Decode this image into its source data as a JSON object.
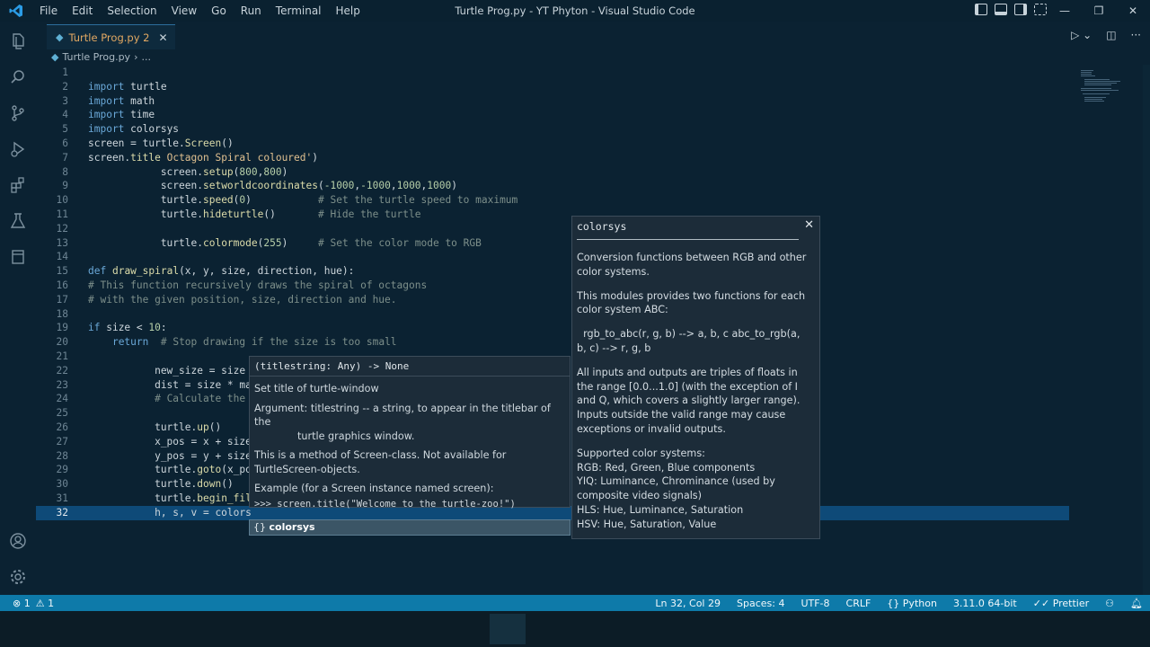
{
  "window": {
    "title": "Turtle Prog.py - YT Phyton - Visual Studio Code",
    "menu": [
      "File",
      "Edit",
      "Selection",
      "View",
      "Go",
      "Run",
      "Terminal",
      "Help"
    ],
    "controls": [
      "—",
      "❐",
      "✕"
    ]
  },
  "activity": [
    "explorer-icon",
    "search-icon",
    "source-control-icon",
    "run-debug-icon",
    "extensions-icon",
    "testing-icon",
    "remote-icon",
    "account-icon",
    "settings-gear-icon"
  ],
  "tab": {
    "label": "Turtle Prog.py 2",
    "close": "✕"
  },
  "breadcrumb": {
    "file": "Turtle Prog.py",
    "sep": "›",
    "rest": "..."
  },
  "editor": {
    "current_line": 32,
    "lines": [
      {
        "n": "1",
        "html": ""
      },
      {
        "n": "2",
        "html": "<span class='kw'>import</span> turtle"
      },
      {
        "n": "3",
        "html": "<span class='kw'>import</span> math"
      },
      {
        "n": "4",
        "html": "<span class='kw'>import</span> time"
      },
      {
        "n": "5",
        "html": "<span class='kw'>import</span> colorsys"
      },
      {
        "n": "6",
        "html": "screen = turtle.<span class='fn'>Screen</span>()"
      },
      {
        "n": "7",
        "html": "screen.<span class='fn'>title</span> <span class='str'>Octagon Spiral coloured'</span>)"
      },
      {
        "n": "8",
        "html": "            screen.<span class='fn'>setup</span>(<span class='num'>800</span>,<span class='num'>800</span>)"
      },
      {
        "n": "9",
        "html": "            screen.<span class='fn'>setworldcoordinates</span>(<span class='num'>-1000</span>,<span class='num'>-1000</span>,<span class='num'>1000</span>,<span class='num'>1000</span>)"
      },
      {
        "n": "10",
        "html": "            turtle.<span class='fn'>speed</span>(<span class='num'>0</span>)           <span class='cm'># Set the turtle speed to maximum</span>"
      },
      {
        "n": "11",
        "html": "            turtle.<span class='fn'>hideturtle</span>()       <span class='cm'># Hide the turtle</span>"
      },
      {
        "n": "12",
        "html": ""
      },
      {
        "n": "13",
        "html": "            turtle.<span class='fn'>colormode</span>(<span class='num'>255</span>)     <span class='cm'># Set the color mode to RGB</span>"
      },
      {
        "n": "14",
        "html": ""
      },
      {
        "n": "15",
        "html": "<span class='kw'>def</span> <span class='fn'>draw_spiral</span>(x, y, size, direction, hue):"
      },
      {
        "n": "16",
        "html": "<span class='cm'># This function recursively draws the spiral of octagons</span>"
      },
      {
        "n": "17",
        "html": "<span class='cm'># with the given position, size, direction and hue.</span>"
      },
      {
        "n": "18",
        "html": ""
      },
      {
        "n": "19",
        "html": "<span class='kw'>if</span> size &lt; <span class='num'>10</span>:"
      },
      {
        "n": "20",
        "html": "    <span class='kw'>return</span>  <span class='cm'># Stop drawing if the size is too small</span>"
      },
      {
        "n": "21",
        "html": ""
      },
      {
        "n": "22",
        "html": "           new_size = size"
      },
      {
        "n": "23",
        "html": "           dist = size * ma"
      },
      {
        "n": "24",
        "html": "           <span class='cm'># Calculate the</span>"
      },
      {
        "n": "25",
        "html": ""
      },
      {
        "n": "26",
        "html": "           turtle.<span class='fn'>up</span>()"
      },
      {
        "n": "27",
        "html": "           x_pos = x + size"
      },
      {
        "n": "28",
        "html": "           y_pos = y + size"
      },
      {
        "n": "29",
        "html": "           turtle.<span class='fn'>goto</span>(x_po"
      },
      {
        "n": "30",
        "html": "           turtle.<span class='fn'>down</span>()"
      },
      {
        "n": "31",
        "html": "           turtle.<span class='fn'>begin_fil</span>"
      },
      {
        "n": "32",
        "html": "           h, s, v = colors"
      }
    ]
  },
  "signature": {
    "header": "(titlestring: Any) -> None",
    "p1": "Set title of turtle-window",
    "p2a": "Argument: titlestring -- a string, to appear in the titlebar of the",
    "p2b": "turtle graphics window.",
    "p3": "This is a method of Screen-class. Not available for TurtleScreen-objects.",
    "p4": "Example (for a Screen instance named screen):",
    "p5": ">>> screen.title(\"Welcome to the turtle-zoo!\")"
  },
  "suggestion": {
    "icon": "{}",
    "label": "colorsys"
  },
  "doc": {
    "title": "colorsys",
    "close": "✕",
    "p1": "Conversion functions between RGB and other color systems.",
    "p2": "This modules provides two functions for each color system ABC:",
    "p3": "  rgb_to_abc(r, g, b) --> a, b, c abc_to_rgb(a, b, c) --> r, g, b",
    "p4": "All inputs and outputs are triples of floats in the range [0.0...1.0] (with the exception of I and Q, which covers a slightly larger range). Inputs outside the valid range may cause exceptions or invalid outputs.",
    "p5_head": "Supported color systems:",
    "systems": [
      "RGB: Red, Green, Blue components",
      "YIQ: Luminance, Chrominance (used by composite video signals)",
      "HLS: Hue, Luminance, Saturation",
      "HSV: Hue, Saturation, Value"
    ]
  },
  "status": {
    "errors": "⊗ 1",
    "warnings": "⚠ 1",
    "position": "Ln 32, Col 29",
    "spaces": "Spaces: 4",
    "encoding": "UTF-8",
    "eol": "CRLF",
    "language": "Python",
    "interpreter": "3.11.0 64-bit",
    "prettier": "Prettier",
    "colors": {
      "bar": "#0e7aa9"
    }
  }
}
